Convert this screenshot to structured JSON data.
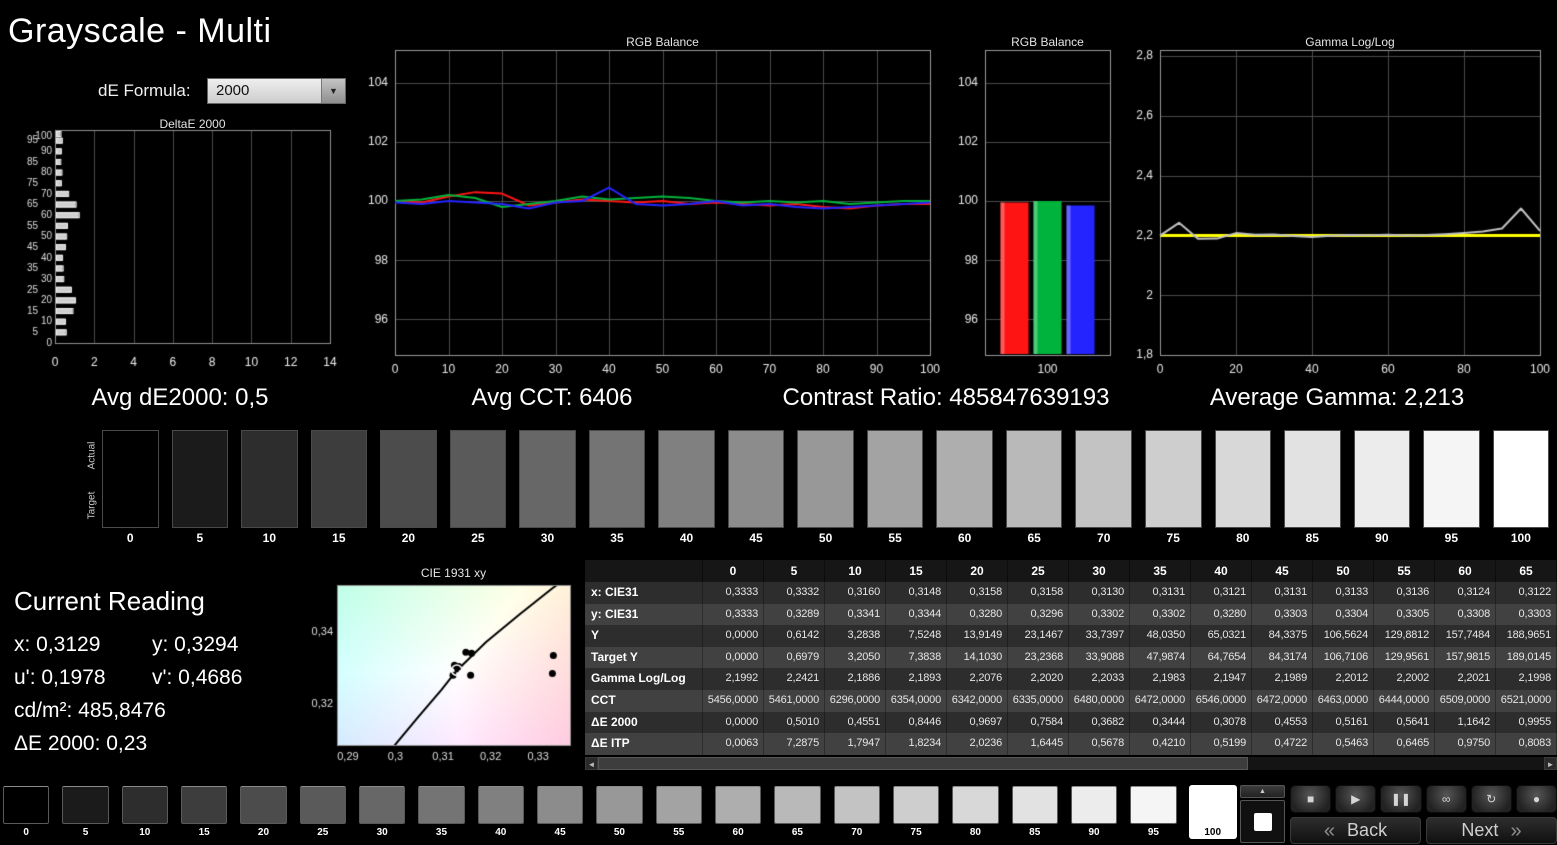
{
  "title": "Grayscale - Multi",
  "controls": {
    "de_formula_label": "dE Formula:",
    "de_formula_value": "2000"
  },
  "icons": {
    "dropdown_arrow": "▼",
    "spin_up": "▲",
    "scroll_left": "◄",
    "scroll_right": "►",
    "back_chevron": "«",
    "next_chevron": "»"
  },
  "stats": {
    "avg_de": "Avg dE2000: 0,5",
    "avg_cct": "Avg CCT: 6406",
    "contrast": "Contrast Ratio: 485847639193",
    "avg_gamma": "Average Gamma: 2,213"
  },
  "levels": [
    "0",
    "5",
    "10",
    "15",
    "20",
    "25",
    "30",
    "35",
    "40",
    "45",
    "50",
    "55",
    "60",
    "65",
    "70",
    "75",
    "80",
    "85",
    "90",
    "95",
    "100"
  ],
  "strip": {
    "row_labels": [
      "Actual",
      "Target"
    ]
  },
  "current_reading": {
    "heading": "Current Reading",
    "pairs": [
      [
        "x: 0,3129",
        "y: 0,3294"
      ],
      [
        "u': 0,1978",
        "v': 0,4686"
      ],
      [
        "cd/m²: 485,8476",
        ""
      ],
      [
        "ΔE 2000: 0,23",
        ""
      ]
    ]
  },
  "table": {
    "columns": [
      "0",
      "5",
      "10",
      "15",
      "20",
      "25",
      "30",
      "35",
      "40",
      "45",
      "50",
      "55",
      "60",
      "65"
    ],
    "rows": [
      {
        "label": "x: CIE31",
        "values": [
          "0,3333",
          "0,3332",
          "0,3160",
          "0,3148",
          "0,3158",
          "0,3158",
          "0,3130",
          "0,3131",
          "0,3121",
          "0,3131",
          "0,3133",
          "0,3136",
          "0,3124",
          "0,3122"
        ]
      },
      {
        "label": "y: CIE31",
        "values": [
          "0,3333",
          "0,3289",
          "0,3341",
          "0,3344",
          "0,3280",
          "0,3296",
          "0,3302",
          "0,3302",
          "0,3280",
          "0,3303",
          "0,3304",
          "0,3305",
          "0,3308",
          "0,3303"
        ]
      },
      {
        "label": "Y",
        "values": [
          "0,0000",
          "0,6142",
          "3,2838",
          "7,5248",
          "13,9149",
          "23,1467",
          "33,7397",
          "48,0350",
          "65,0321",
          "84,3375",
          "106,5624",
          "129,8812",
          "157,7484",
          "188,9651"
        ]
      },
      {
        "label": "Target Y",
        "values": [
          "0,0000",
          "0,6979",
          "3,2050",
          "7,3838",
          "14,1030",
          "23,2368",
          "33,9088",
          "47,9874",
          "64,7654",
          "84,3174",
          "106,7106",
          "129,9561",
          "157,9815",
          "189,0145"
        ]
      },
      {
        "label": "Gamma Log/Log",
        "values": [
          "2,1992",
          "2,2421",
          "2,1886",
          "2,1893",
          "2,2076",
          "2,2020",
          "2,2033",
          "2,1983",
          "2,1947",
          "2,1989",
          "2,2012",
          "2,2002",
          "2,2021",
          "2,1998"
        ]
      },
      {
        "label": "CCT",
        "values": [
          "5456,0000",
          "5461,0000",
          "6296,0000",
          "6354,0000",
          "6342,0000",
          "6335,0000",
          "6480,0000",
          "6472,0000",
          "6546,0000",
          "6472,0000",
          "6463,0000",
          "6444,0000",
          "6509,0000",
          "6521,0000"
        ]
      },
      {
        "label": "ΔE 2000",
        "values": [
          "0,0000",
          "0,5010",
          "0,4551",
          "0,8446",
          "0,9697",
          "0,7584",
          "0,3682",
          "0,3444",
          "0,3078",
          "0,4553",
          "0,5161",
          "0,5641",
          "1,1642",
          "0,9955"
        ]
      },
      {
        "label": "ΔE ITP",
        "values": [
          "0,0063",
          "7,2875",
          "1,7947",
          "1,8234",
          "2,0236",
          "1,6445",
          "0,5678",
          "0,4210",
          "0,5199",
          "0,4722",
          "0,5463",
          "0,6465",
          "0,9750",
          "0,8083"
        ]
      }
    ]
  },
  "transport": {
    "selected_level": "100",
    "buttons": [
      {
        "name": "stop",
        "glyph": "■"
      },
      {
        "name": "play",
        "glyph": "▶"
      },
      {
        "name": "pause",
        "glyph": "❚❚"
      },
      {
        "name": "continuous",
        "glyph": "∞"
      },
      {
        "name": "loop",
        "glyph": "↻"
      },
      {
        "name": "record",
        "glyph": "●"
      }
    ],
    "back_label": "Back",
    "next_label": "Next"
  },
  "chart_data": [
    {
      "name": "deltae",
      "type": "bar",
      "title": "DeltaE 2000",
      "orientation": "horizontal",
      "x_ticks": [
        0,
        2,
        4,
        6,
        8,
        10,
        12,
        14
      ],
      "xlim": [
        0,
        14
      ],
      "y_categories": [
        0,
        5,
        10,
        15,
        20,
        25,
        30,
        35,
        40,
        45,
        50,
        55,
        60,
        65,
        70,
        75,
        80,
        85,
        90,
        95,
        100
      ],
      "values": [
        0,
        0.5,
        0.46,
        0.84,
        0.97,
        0.76,
        0.37,
        0.34,
        0.31,
        0.46,
        0.52,
        0.56,
        1.16,
        1.0,
        0.62,
        0.25,
        0.28,
        0.22,
        0.25,
        0.3,
        0.23
      ]
    },
    {
      "name": "rgb_balance_line",
      "type": "line",
      "title": "RGB Balance",
      "x": [
        0,
        5,
        10,
        15,
        20,
        25,
        30,
        35,
        40,
        45,
        50,
        55,
        60,
        65,
        70,
        75,
        80,
        85,
        90,
        95,
        100
      ],
      "x_ticks": [
        0,
        10,
        20,
        30,
        40,
        50,
        60,
        70,
        80,
        90,
        100
      ],
      "y_ticks": [
        96,
        98,
        100,
        102,
        104
      ],
      "ylim": [
        94.8,
        105.1
      ],
      "series": [
        {
          "name": "Red",
          "color": "#ff1414",
          "values": [
            100.0,
            99.95,
            100.15,
            100.3,
            100.25,
            99.85,
            99.95,
            100.05,
            100.0,
            99.95,
            100.0,
            99.9,
            99.95,
            99.9,
            99.85,
            99.9,
            99.8,
            99.75,
            99.85,
            99.9,
            99.9
          ]
        },
        {
          "name": "Green",
          "color": "#00b33c",
          "values": [
            100.0,
            100.05,
            100.2,
            100.1,
            99.8,
            99.9,
            100.0,
            100.15,
            100.05,
            100.1,
            100.15,
            100.1,
            100.0,
            99.95,
            100.0,
            99.95,
            100.0,
            99.9,
            99.95,
            100.0,
            100.0
          ]
        },
        {
          "name": "Blue",
          "color": "#2424ff",
          "values": [
            99.95,
            99.9,
            100.0,
            99.95,
            99.9,
            99.75,
            99.95,
            100.0,
            100.45,
            99.9,
            99.85,
            99.9,
            100.0,
            99.85,
            99.9,
            99.8,
            99.75,
            99.8,
            99.85,
            99.9,
            99.95
          ]
        }
      ]
    },
    {
      "name": "rgb_balance_bars",
      "type": "bar",
      "title": "RGB Balance",
      "x_label": "100",
      "y_ticks": [
        96,
        98,
        100,
        102,
        104
      ],
      "ylim": [
        94.8,
        105.1
      ],
      "series": [
        {
          "name": "Red",
          "color": "#ff1414",
          "value": 99.95
        },
        {
          "name": "Green",
          "color": "#00b33c",
          "value": 100.0
        },
        {
          "name": "Blue",
          "color": "#2424ff",
          "value": 99.85
        }
      ]
    },
    {
      "name": "gamma",
      "type": "line",
      "title": "Gamma Log/Log",
      "x": [
        0,
        5,
        10,
        15,
        20,
        25,
        30,
        35,
        40,
        45,
        50,
        55,
        60,
        65,
        70,
        75,
        80,
        85,
        90,
        95,
        100
      ],
      "x_ticks": [
        0,
        20,
        40,
        60,
        80,
        100
      ],
      "y_ticks": [
        "2,8",
        "2,6",
        "2,4",
        "2,2",
        "2",
        "1,8"
      ],
      "y_tick_values": [
        2.8,
        2.6,
        2.4,
        2.2,
        2.0,
        1.8
      ],
      "ylim": [
        1.8,
        2.82
      ],
      "target": 2.2,
      "target_color": "#ffff00",
      "line_color": "#c0c0c0",
      "values": [
        2.1992,
        2.2421,
        2.1886,
        2.1893,
        2.2076,
        2.202,
        2.2033,
        2.1983,
        2.1947,
        2.1989,
        2.2012,
        2.2002,
        2.2021,
        2.1998,
        2.201,
        2.204,
        2.208,
        2.213,
        2.223,
        2.29,
        2.215
      ]
    },
    {
      "name": "cie",
      "type": "scatter",
      "title": "CIE 1931 xy",
      "x_ticks": [
        "0,29",
        "0,3",
        "0,31",
        "0,32",
        "0,33"
      ],
      "x_tick_values": [
        0.29,
        0.3,
        0.31,
        0.32,
        0.33
      ],
      "y_ticks": [
        "0,34",
        "0,32"
      ],
      "y_tick_values": [
        0.34,
        0.32
      ],
      "xlim": [
        0.2877,
        0.3367
      ],
      "ylim": [
        0.3086,
        0.3531
      ],
      "locus": [
        [
          0.2995,
          0.308
        ],
        [
          0.3048,
          0.3164
        ],
        [
          0.3097,
          0.324
        ],
        [
          0.3128,
          0.3292
        ],
        [
          0.319,
          0.3372
        ],
        [
          0.326,
          0.3448
        ],
        [
          0.333,
          0.3522
        ],
        [
          0.3355,
          0.3545
        ]
      ],
      "points": [
        [
          0.3148,
          0.3344
        ],
        [
          0.316,
          0.3341
        ],
        [
          0.3158,
          0.328
        ],
        [
          0.3124,
          0.3308
        ],
        [
          0.3133,
          0.3304
        ],
        [
          0.3121,
          0.328
        ],
        [
          0.313,
          0.3302
        ]
      ],
      "outlier_points": [
        [
          0.3332,
          0.3335
        ],
        [
          0.333,
          0.3285
        ]
      ],
      "marker": [
        0.3129,
        0.3294
      ]
    }
  ]
}
